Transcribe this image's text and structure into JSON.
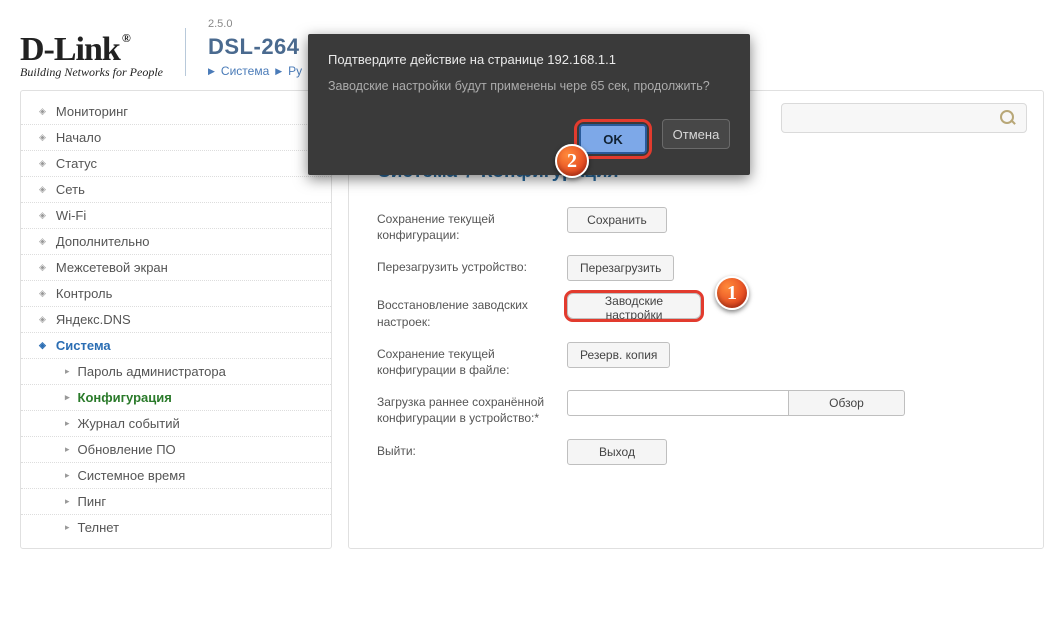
{
  "logo": {
    "text": "D-Link",
    "reg": "®",
    "tagline": "Building Networks for People"
  },
  "header": {
    "version": "2.5.0",
    "model": "DSL-264",
    "crumb1": "Система",
    "crumb2": "Ру"
  },
  "sidebar": {
    "items": [
      {
        "label": "Мониторинг"
      },
      {
        "label": "Начало"
      },
      {
        "label": "Статус"
      },
      {
        "label": "Сеть"
      },
      {
        "label": "Wi-Fi"
      },
      {
        "label": "Дополнительно"
      },
      {
        "label": "Межсетевой экран"
      },
      {
        "label": "Контроль"
      },
      {
        "label": "Яндекс.DNS"
      },
      {
        "label": "Система",
        "active": true
      }
    ],
    "sub": [
      {
        "label": "Пароль администратора"
      },
      {
        "label": "Конфигурация",
        "active": true
      },
      {
        "label": "Журнал событий"
      },
      {
        "label": "Обновление ПО"
      },
      {
        "label": "Системное время"
      },
      {
        "label": "Пинг"
      },
      {
        "label": "Телнет"
      }
    ]
  },
  "main": {
    "title_section": "Система",
    "title_sep": "/",
    "title_page": "Конфигурация",
    "rows": {
      "save": {
        "label": "Сохранение текущей конфигурации:",
        "btn": "Сохранить"
      },
      "reboot": {
        "label": "Перезагрузить устройство:",
        "btn": "Перезагрузить"
      },
      "factory": {
        "label": "Восстановление заводских настроек:",
        "btn": "Заводские настройки"
      },
      "backup": {
        "label": "Сохранение текущей конфигурации в файле:",
        "btn": "Резерв. копия"
      },
      "restore": {
        "label": "Загрузка раннее сохранённой конфигурации в устройство:*",
        "btn": "Обзор"
      },
      "exit": {
        "label": "Выйти:",
        "btn": "Выход"
      }
    }
  },
  "modal": {
    "title": "Подтвердите действие на странице 192.168.1.1",
    "message": "Заводские настройки будут применены чере 65 сек, продолжить?",
    "ok": "OK",
    "cancel": "Отмена"
  },
  "steps": {
    "one": "1",
    "two": "2"
  }
}
